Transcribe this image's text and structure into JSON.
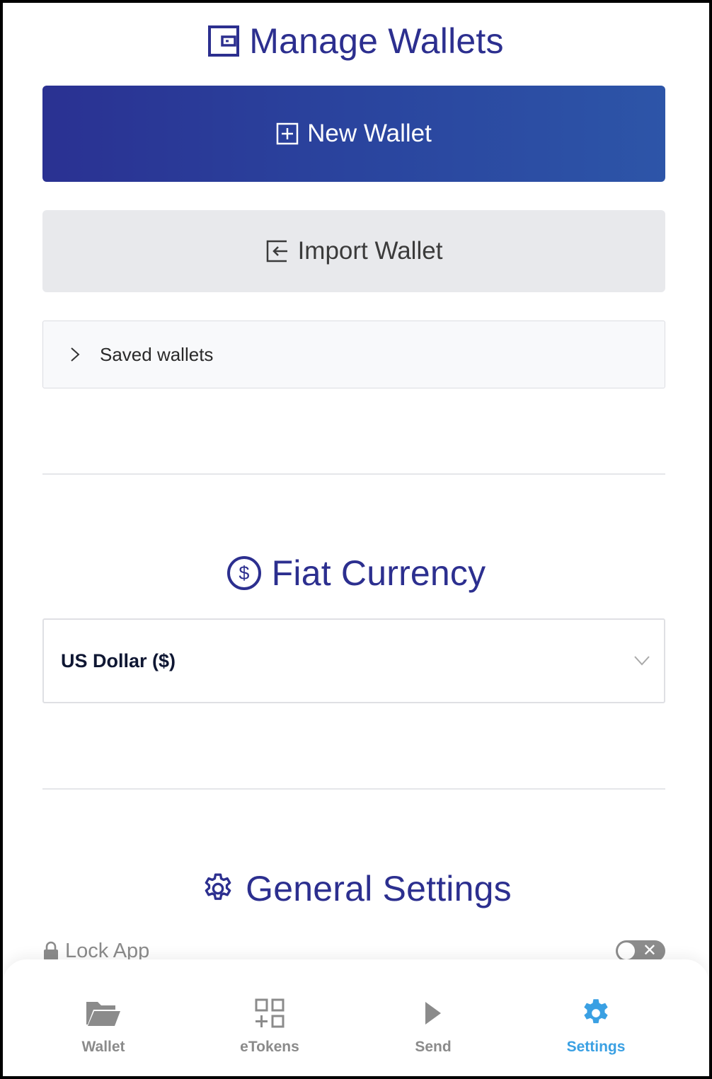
{
  "manage_wallets": {
    "title": "Manage Wallets",
    "icon": "wallet-icon",
    "new_wallet_label": "New Wallet",
    "import_wallet_label": "Import Wallet",
    "saved_wallets_label": "Saved wallets"
  },
  "fiat_currency": {
    "title": "Fiat Currency",
    "icon": "dollar-circle-icon",
    "selected": "US Dollar ($)"
  },
  "general_settings": {
    "title": "General Settings",
    "icon": "gear-icon",
    "lock_app_label": "Lock App",
    "lock_app_enabled": false
  },
  "nav": {
    "items": [
      {
        "label": "Wallet",
        "icon": "folder-open-icon",
        "active": false
      },
      {
        "label": "eTokens",
        "icon": "append-icon",
        "active": false
      },
      {
        "label": "Send",
        "icon": "play-icon",
        "active": false
      },
      {
        "label": "Settings",
        "icon": "gear-icon",
        "active": true
      }
    ]
  },
  "colors": {
    "title": "#2c2f8f",
    "primary_gradient_start": "#2a3192",
    "primary_gradient_end": "#2d55a8",
    "nav_active": "#3aa0e3",
    "nav_inactive": "#8b8b8b"
  }
}
